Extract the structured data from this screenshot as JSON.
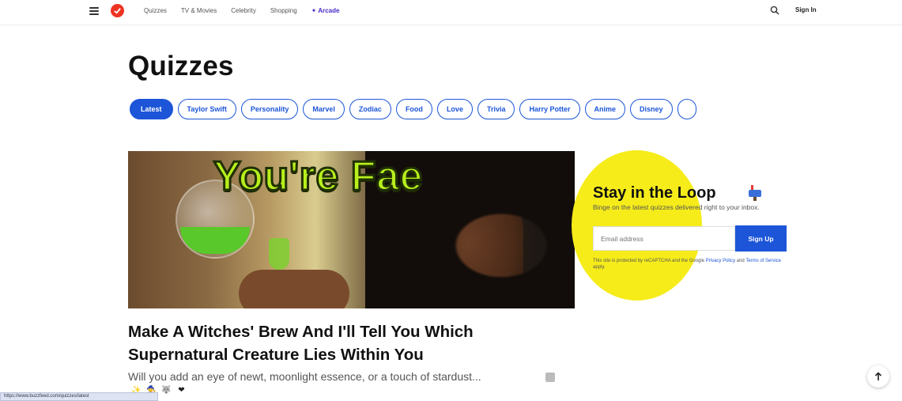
{
  "nav": {
    "links": [
      "Quizzes",
      "TV & Movies",
      "Celebrity",
      "Shopping"
    ],
    "arcade_label": "Arcade",
    "signin_label": "Sign In",
    "icons": {
      "menu": "hamburger-icon",
      "logo": "buzzfeed-logo",
      "search": "search-icon"
    }
  },
  "page_title": "Quizzes",
  "pills": [
    "Latest",
    "Taylor Swift",
    "Personality",
    "Marvel",
    "Zodiac",
    "Food",
    "Love",
    "Trivia",
    "Harry Potter",
    "Anime",
    "Disney"
  ],
  "active_pill": "Latest",
  "hero": {
    "overlay_text": "You're Fae"
  },
  "newsletter": {
    "title": "Stay in the Loop",
    "subtitle": "Binge on the latest quizzes delivered right to your inbox.",
    "email_placeholder": "Email address",
    "signup_label": "Sign Up",
    "recaptcha_pre": "This site is protected by reCAPTCHA and the Google ",
    "privacy_link": "Privacy Policy",
    "recaptcha_mid": " and ",
    "terms_link": "Terms of Service",
    "recaptcha_post": " apply."
  },
  "article": {
    "title": "Make A Witches' Brew And I'll Tell You Which Supernatural Creature Lies Within You",
    "description": "Will you add an eye of newt, moonlight essence, or a touch of stardust..."
  },
  "reactions": [
    "✨",
    "🧙",
    "🐺",
    "❤"
  ],
  "status_url": "https://www.buzzfeed.com/quizzes/latest",
  "colors": {
    "brand_red": "#ee3322",
    "accent_blue": "#1c55d8",
    "yellow": "#f6ec1a",
    "hero_text": "#b8ef1c"
  }
}
